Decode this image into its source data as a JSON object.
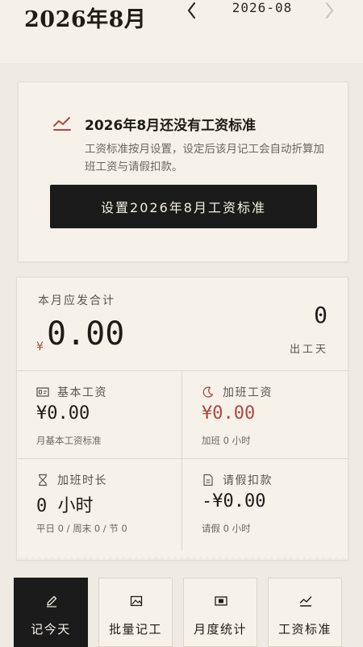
{
  "header": {
    "title": "2026年8月",
    "month_label": "2026-08"
  },
  "notice": {
    "title": "2026年8月还没有工资标准",
    "description": "工资标准按月设置，设定后该月记工会自动折算加班工资与请假扣款。",
    "button_label": "设置2026年8月工资标准",
    "icon": "trend-chart-icon"
  },
  "summary": {
    "total_label": "本月应发合计",
    "currency": "¥",
    "total_amount": "0.00",
    "days_value": "0",
    "days_label": "出工天",
    "cells": [
      {
        "icon": "id-card-icon",
        "label": "基本工资",
        "value": "¥0.00",
        "sub": "月基本工资标准"
      },
      {
        "icon": "moon-icon",
        "label": "加班工资",
        "value": "¥0.00",
        "sub": "加班 0 小时"
      },
      {
        "icon": "hourglass-icon",
        "label": "加班时长",
        "value": "0 小时",
        "sub": "平日 0 / 周末 0 / 节 0"
      },
      {
        "icon": "document-icon",
        "label": "请假扣款",
        "value": "-¥0.00",
        "sub": "请假 0 小时"
      }
    ]
  },
  "bottom_nav": [
    {
      "label": "记今天",
      "icon": "pencil-icon",
      "active": true
    },
    {
      "label": "批量记工",
      "icon": "image-icon",
      "active": false
    },
    {
      "label": "月度统计",
      "icon": "ticket-icon",
      "active": false
    },
    {
      "label": "工资标准",
      "icon": "trend-chart-icon",
      "active": false
    }
  ],
  "colors": {
    "accent_red": "#b0473c",
    "dark": "#1b1b1b",
    "background": "#efebe3",
    "card": "#f6f2ea"
  }
}
